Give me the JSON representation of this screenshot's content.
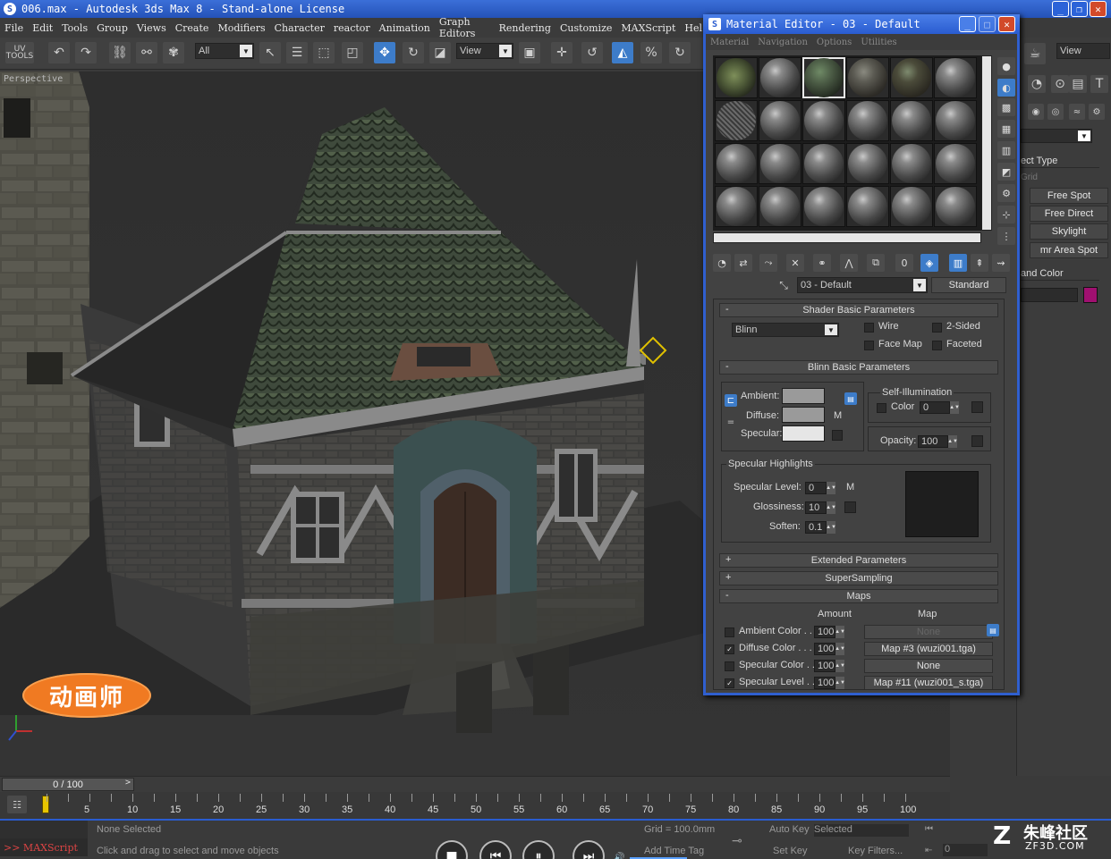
{
  "window": {
    "title": "006.max - Autodesk 3ds Max 8 - Stand-alone License"
  },
  "menu": [
    "File",
    "Edit",
    "Tools",
    "Group",
    "Views",
    "Create",
    "Modifiers",
    "Character",
    "reactor",
    "Animation",
    "Graph Editors",
    "Rendering",
    "Customize",
    "MAXScript",
    "Hel"
  ],
  "toolbar": {
    "uv_label": "UV\nTOOLS",
    "selection_filter": "All",
    "ref_coord": "View"
  },
  "viewport": {
    "label": "Perspective",
    "logo_text": "动画师"
  },
  "command_panel": {
    "view_combo": "View",
    "object_type_header": "ect Type",
    "autogrid": "Grid",
    "buttons": [
      "Free Spot",
      "Free Direct",
      "Skylight",
      "mr Area Spot"
    ],
    "name_color_header": "and Color",
    "color_swatch": "#a01070"
  },
  "material_editor": {
    "title": "Material Editor - 03 - Default",
    "menu": [
      "Material",
      "Navigation",
      "Options",
      "Utilities"
    ],
    "material_name": "03 - Default",
    "material_type": "Standard",
    "shader_basic": {
      "header": "Shader Basic Parameters",
      "shader": "Blinn",
      "wire": "Wire",
      "two_sided": "2-Sided",
      "face_map": "Face Map",
      "faceted": "Faceted"
    },
    "blinn_basic": {
      "header": "Blinn Basic Parameters",
      "ambient": "Ambient:",
      "diffuse": "Diffuse:",
      "specular": "Specular:",
      "map_m": "M",
      "self_illum": "Self-Illumination",
      "color_label": "Color",
      "color_value": "0",
      "opacity_label": "Opacity:",
      "opacity_value": "100",
      "ambient_color": "#9a9a9a",
      "diffuse_color": "#9a9a9a",
      "specular_color": "#e6e6e6"
    },
    "specular_highlights": {
      "header": "Specular Highlights",
      "level_label": "Specular Level:",
      "level_value": "0",
      "gloss_label": "Glossiness:",
      "gloss_value": "10",
      "soften_label": "Soften:",
      "soften_value": "0.1",
      "map_m": "M"
    },
    "rollouts": {
      "extended": "Extended Parameters",
      "supersampling": "SuperSampling",
      "maps": "Maps"
    },
    "maps": {
      "amount_header": "Amount",
      "map_header": "Map",
      "rows": [
        {
          "label": "Ambient Color . . .",
          "amount": "100",
          "map": "None",
          "checked": false,
          "dim": true
        },
        {
          "label": "Diffuse Color . . . .",
          "amount": "100",
          "map": "Map #3 (wuzi001.tga)",
          "checked": true,
          "dim": false
        },
        {
          "label": "Specular Color . . .",
          "amount": "100",
          "map": "None",
          "checked": false,
          "dim": false
        },
        {
          "label": "Specular Level . .",
          "amount": "100",
          "map": "Map #11 (wuzi001_s.tga)",
          "checked": true,
          "dim": false
        }
      ]
    }
  },
  "time": {
    "slider": "0 / 100",
    "ticks": [
      "5",
      "10",
      "15",
      "20",
      "25",
      "30",
      "35",
      "40",
      "45",
      "50",
      "55",
      "60",
      "65",
      "70",
      "75",
      "80",
      "85",
      "90",
      "95",
      "100"
    ]
  },
  "status": {
    "maxscript": ">> MAXScript",
    "selection": "None Selected",
    "prompt": "Click and drag to select and move objects",
    "grid": "Grid = 100.0mm",
    "auto_key": "Auto Key",
    "selected": "Selected",
    "set_key": "Set Key",
    "key_filters": "Key Filters...",
    "add_time_tag": "Add Time Tag",
    "frame": "0"
  },
  "watermark": {
    "logo": "Z",
    "name": "朱峰社区",
    "url": "ZF3D.COM"
  }
}
